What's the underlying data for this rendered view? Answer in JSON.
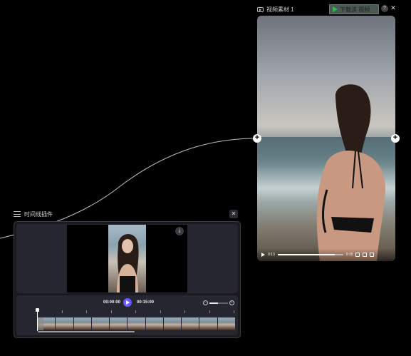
{
  "video_node": {
    "title": "视频素材 1",
    "download_label": "下载该 视频",
    "help_label": "?",
    "close_label": "✕",
    "current_time": "0:13",
    "duration": "0:15",
    "progress_fraction": 0.87
  },
  "ports": {
    "plus": "+"
  },
  "timeline": {
    "title": "时间线插件",
    "close_label": "✕",
    "start_time": "00:00:00",
    "end_time": "00:15:00",
    "zoom_out": "−",
    "zoom_in": "+",
    "zoom_fraction": 0.45,
    "download_icon": "download-icon",
    "frame_count": 11,
    "scroll_fraction": 0.49
  },
  "icons": {
    "video": "video-icon",
    "timeline": "timeline-icon",
    "play": "play-icon"
  },
  "colors": {
    "background": "#000000",
    "accent": "#6a5cff",
    "download_button": "#4a5a52",
    "download_play": "#24c24a"
  }
}
